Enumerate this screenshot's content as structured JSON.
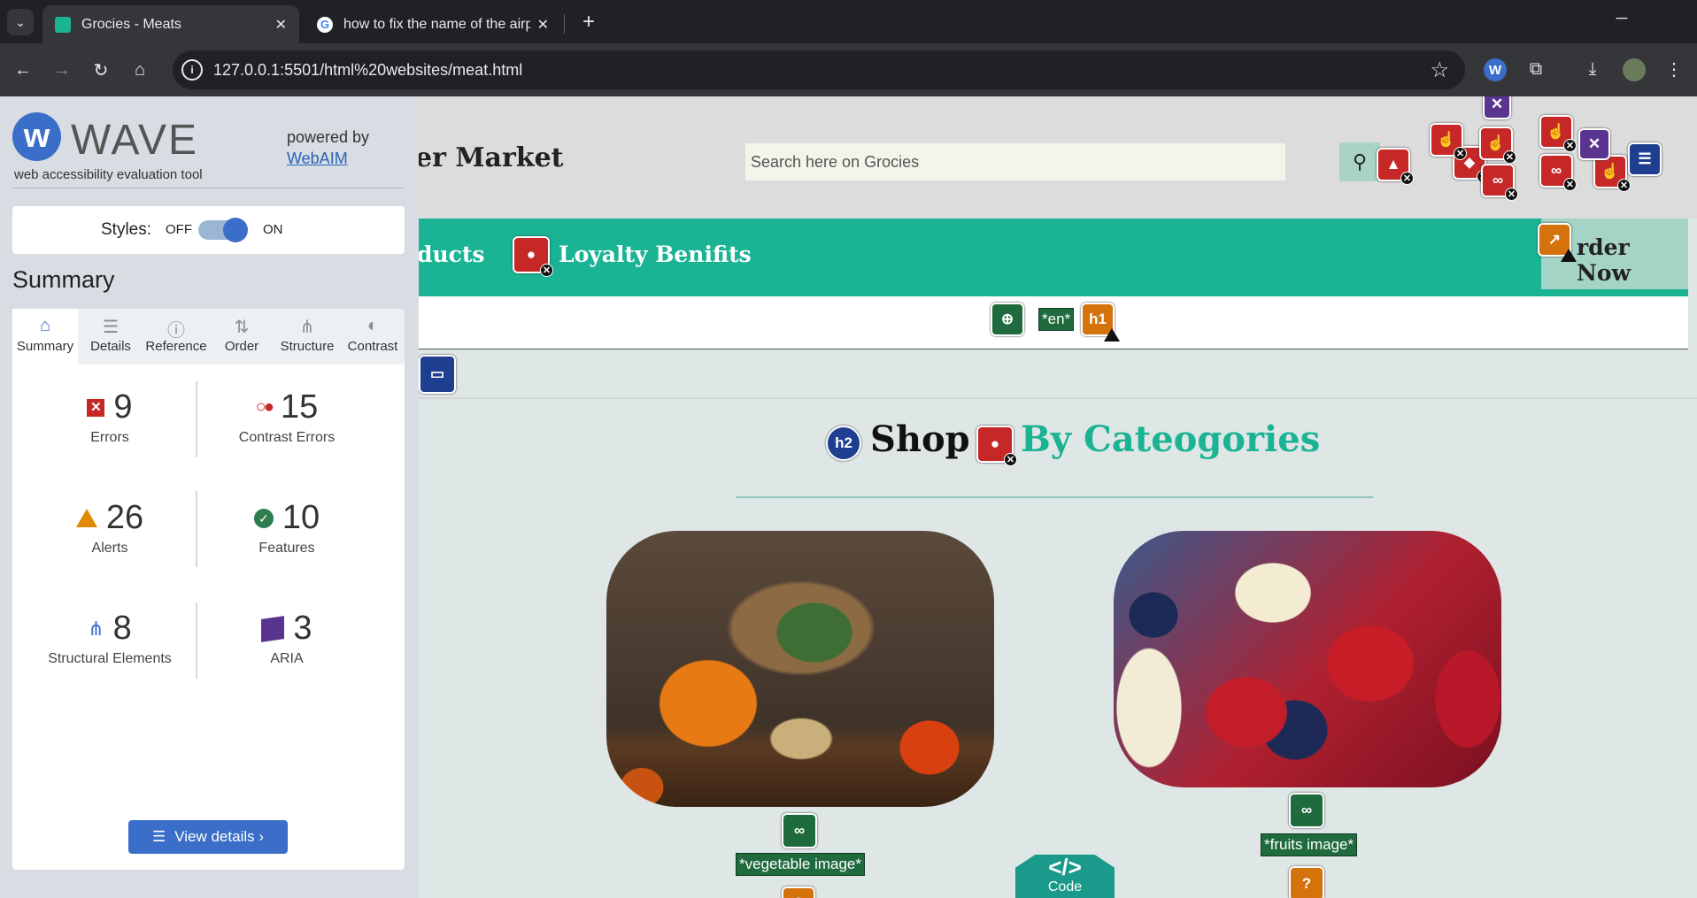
{
  "browser": {
    "tabs": [
      {
        "title": "Grocies - Meats",
        "active": true,
        "favicon": "grocies-icon"
      },
      {
        "title": "how to fix the name of the airp",
        "active": false,
        "favicon": "google-icon"
      }
    ],
    "url": "127.0.0.1:5501/html%20websites/meat.html",
    "new_tab": "+",
    "close": "✕"
  },
  "wave": {
    "name": "WAVE",
    "subtitle": "web accessibility evaluation tool",
    "powered_by": "powered by",
    "powered_link": "WebAIM",
    "styles_label": "Styles:",
    "styles_off": "OFF",
    "styles_on": "ON",
    "summary_heading": "Summary",
    "tabs": [
      {
        "label": "Summary",
        "icon": "home-icon",
        "glyph": "⌂"
      },
      {
        "label": "Details",
        "icon": "list-icon",
        "glyph": "☰"
      },
      {
        "label": "Reference",
        "icon": "info-icon",
        "glyph": "ⓘ"
      },
      {
        "label": "Order",
        "icon": "order-icon",
        "glyph": "⇅"
      },
      {
        "label": "Structure",
        "icon": "structure-icon",
        "glyph": "⋔"
      },
      {
        "label": "Contrast",
        "icon": "contrast-icon",
        "glyph": "◐"
      }
    ],
    "stats": {
      "errors": {
        "value": "9",
        "label": "Errors"
      },
      "contrast": {
        "value": "15",
        "label": "Contrast Errors"
      },
      "alerts": {
        "value": "26",
        "label": "Alerts"
      },
      "features": {
        "value": "10",
        "label": "Features"
      },
      "structural": {
        "value": "8",
        "label": "Structural Elements"
      },
      "aria": {
        "value": "3",
        "label": "ARIA"
      }
    },
    "view_details": "View details ›"
  },
  "page": {
    "brand": "er Market",
    "search_placeholder": "Search here on Grocies",
    "nav": [
      "ducts",
      "Loyalty Benifits"
    ],
    "order_now": "rder Now",
    "lang_tag": "*en*",
    "h1_tag": "h1",
    "h2_tag": "h2",
    "shop_title": "Shop",
    "shop_accent": "By Cateogories",
    "categories": [
      {
        "alt": "*vegetable image*"
      },
      {
        "alt": "*fruits image*"
      }
    ],
    "code_label": "Code",
    "code_symbol": "</>"
  },
  "colors": {
    "accent": "#1ab394",
    "wave_blue": "#3b6ec8",
    "error": "#c62828",
    "feature": "#1f6b3d",
    "alert": "#d4720b"
  }
}
